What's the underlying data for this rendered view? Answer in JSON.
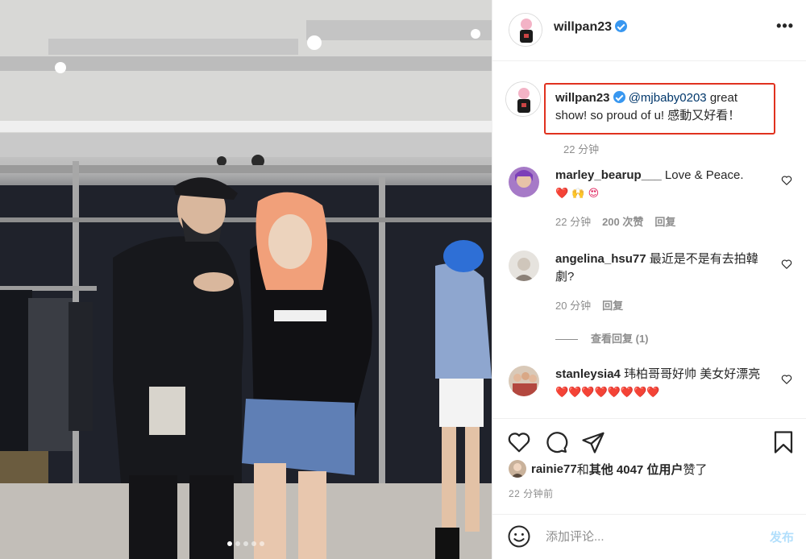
{
  "post": {
    "author": "willpan23",
    "more_label": "•••",
    "carousel": {
      "count": 5,
      "active": 0
    }
  },
  "caption": {
    "username": "willpan23",
    "mention": "@mjbaby0203",
    "text": " great show! so proud of u! 感動又好看！",
    "time": "22 分钟"
  },
  "comments": [
    {
      "username": "marley_bearup___",
      "text": " Love & Peace.",
      "emojis": "❤️ 🙌 😍",
      "time": "22 分钟",
      "likes": "200 次赞",
      "reply": "回复"
    },
    {
      "username": "angelina_hsu77",
      "text": " 最近是不是有去拍韓劇?",
      "time": "20 分钟",
      "reply": "回复",
      "view_replies": "查看回复 (1)"
    },
    {
      "username": "stanleysia4",
      "text": " 玮柏哥哥好帅 美女好漂亮",
      "emojis": "❤️❤️❤️❤️❤️❤️❤️❤️"
    }
  ],
  "likes_line": {
    "user": "rainie77",
    "and": " 和 ",
    "others": "其他 4047 位用户",
    "suffix": " 赞了"
  },
  "timestamp": "22 分钟前",
  "add_comment": {
    "placeholder": "添加评论...",
    "post_label": "发布"
  },
  "colors": {
    "highlight_box": "#e0321f",
    "verified": "#3897f0",
    "post_button_disabled": "#b2dffc",
    "meta_text": "#8e8e8e"
  },
  "icons": [
    "verified-badge-icon",
    "more-options-icon",
    "heart-icon",
    "comment-icon",
    "share-icon",
    "bookmark-icon",
    "emoji-icon"
  ]
}
